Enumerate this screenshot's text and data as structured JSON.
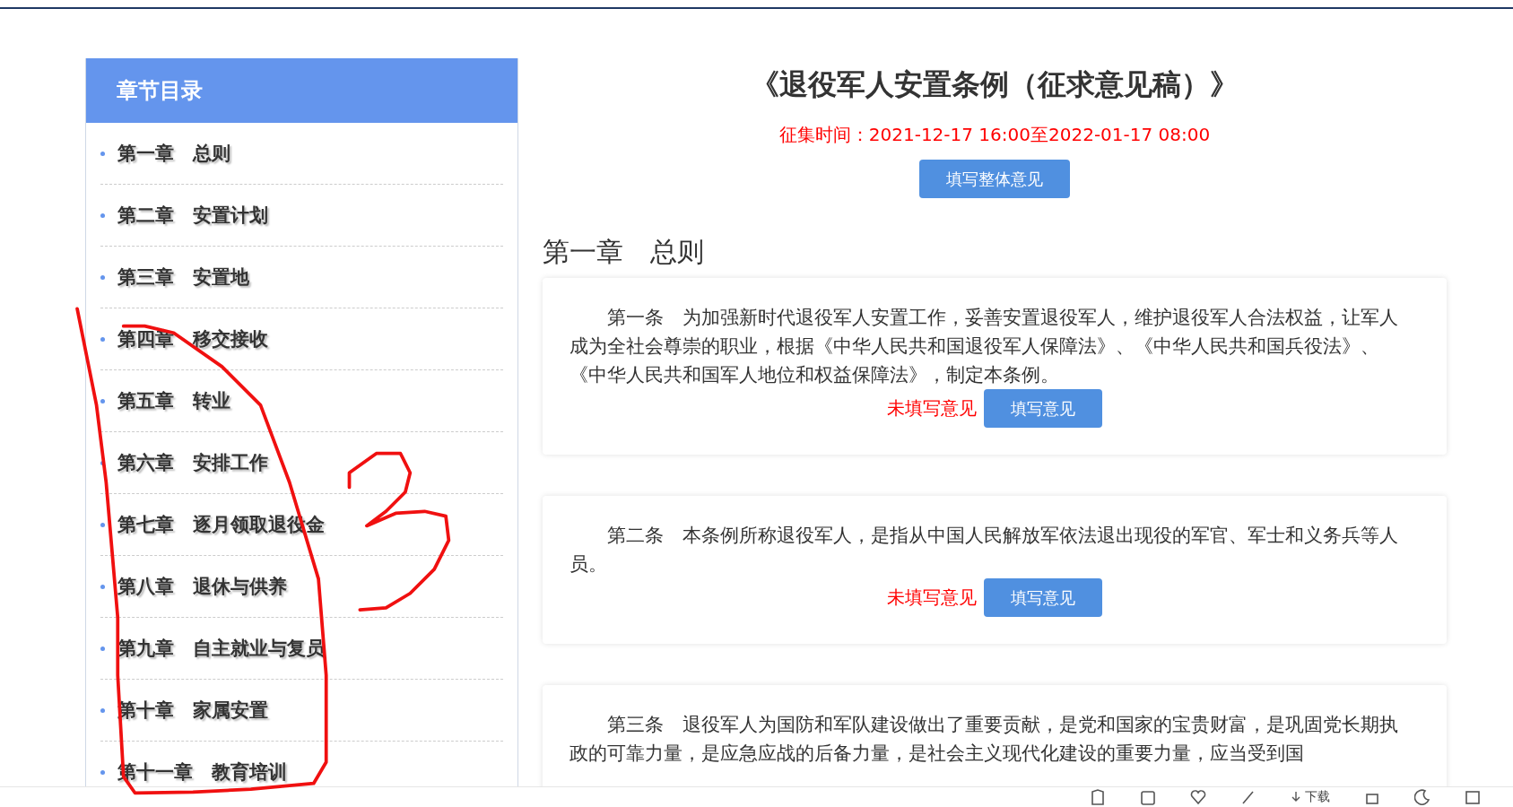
{
  "page": {
    "title": "《退役军人安置条例（征求意见稿）》",
    "period": "征集时间：2021-12-17 16:00至2022-01-17 08:00",
    "overall_button": "填写整体意见"
  },
  "sidebar": {
    "title": "章节目录",
    "items": [
      {
        "label": "第一章　总则"
      },
      {
        "label": "第二章　安置计划"
      },
      {
        "label": "第三章　安置地"
      },
      {
        "label": "第四章　移交接收"
      },
      {
        "label": "第五章　转业"
      },
      {
        "label": "第六章　安排工作"
      },
      {
        "label": "第七章　逐月领取退役金"
      },
      {
        "label": "第八章　退休与供养"
      },
      {
        "label": "第九章　自主就业与复员"
      },
      {
        "label": "第十章　家属安置"
      },
      {
        "label": "第十一章　教育培训"
      }
    ]
  },
  "chapter_heading": "第一章　总则",
  "articles": [
    {
      "text": "第一条　为加强新时代退役军人安置工作，妥善安置退役军人，维护退役军人合法权益，让军人成为全社会尊崇的职业，根据《中华人民共和国退役军人保障法》、《中华人民共和国兵役法》、《中华人民共和国军人地位和权益保障法》，制定本条例。",
      "status": "未填写意见",
      "button": "填写意见"
    },
    {
      "text": "第二条　本条例所称退役军人，是指从中国人民解放军依法退出现役的军官、军士和义务兵等人员。",
      "status": "未填写意见",
      "button": "填写意见"
    },
    {
      "text": "第三条　退役军人为国防和军队建设做出了重要贡献，是党和国家的宝贵财富，是巩固党长期执政的可靠力量，是应急应战的后备力量，是社会主义现代化建设的重要力量，应当受到国"
    }
  ],
  "toolbar": {
    "download": "下载"
  }
}
